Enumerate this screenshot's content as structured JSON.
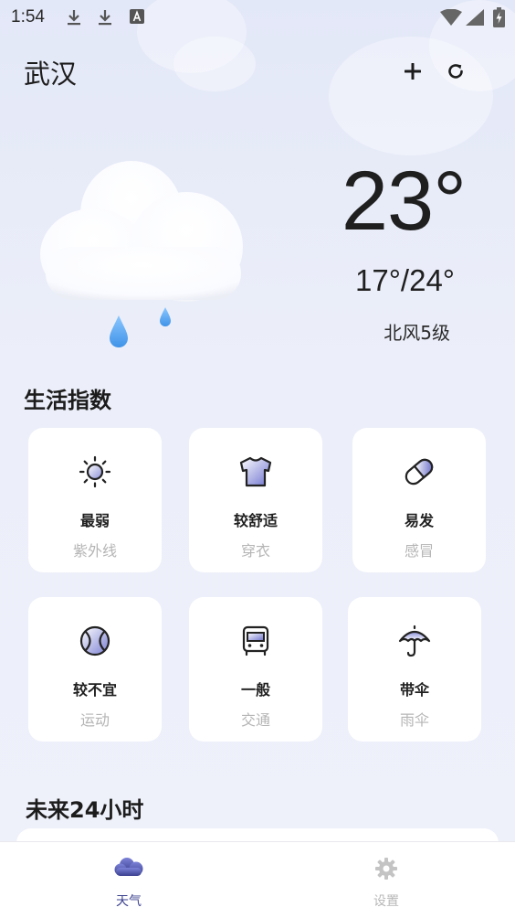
{
  "status_bar": {
    "time": "1:54"
  },
  "header": {
    "city": "武汉"
  },
  "current": {
    "temp": "23°",
    "range": "17°/24°",
    "wind": "北风5级"
  },
  "life_section": {
    "title": "生活指数",
    "items": [
      {
        "value": "最弱",
        "label": "紫外线",
        "icon": "sun-icon"
      },
      {
        "value": "较舒适",
        "label": "穿衣",
        "icon": "shirt-icon"
      },
      {
        "value": "易发",
        "label": "感冒",
        "icon": "pill-icon"
      },
      {
        "value": "较不宜",
        "label": "运动",
        "icon": "ball-icon"
      },
      {
        "value": "一般",
        "label": "交通",
        "icon": "bus-icon"
      },
      {
        "value": "带伞",
        "label": "雨伞",
        "icon": "umbrella-icon"
      }
    ]
  },
  "hourly_section": {
    "title": "未来24小时"
  },
  "nav": {
    "items": [
      {
        "label": "天气",
        "icon": "cloud-icon",
        "active": true
      },
      {
        "label": "设置",
        "icon": "gear-icon",
        "active": false
      }
    ]
  },
  "colors": {
    "accent": "#4a4f9e",
    "muted": "#b5b5b5",
    "card_bg": "#ffffff",
    "rain": "#5aa9f0"
  }
}
